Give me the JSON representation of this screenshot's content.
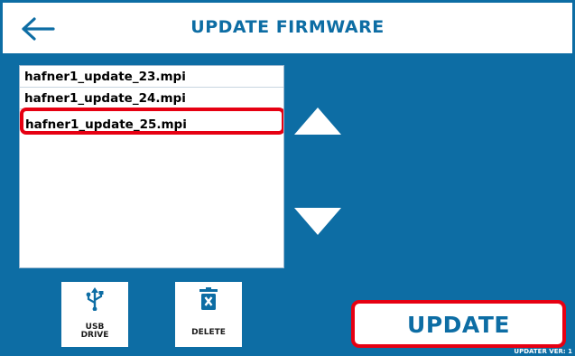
{
  "header": {
    "title": "UPDATE FIRMWARE",
    "back_icon": "left-arrow-icon"
  },
  "files": [
    {
      "name": "hafner1_update_23.mpi",
      "selected": false
    },
    {
      "name": "hafner1_update_24.mpi",
      "selected": false
    },
    {
      "name": "hafner1_update_25.mpi",
      "selected": true
    }
  ],
  "scroll": {
    "up_icon": "triangle-up-icon",
    "down_icon": "triangle-down-icon"
  },
  "tools": {
    "usb": {
      "label_line1": "USB",
      "label_line2": "DRIVE",
      "icon": "usb-icon"
    },
    "delete": {
      "label": "DELETE",
      "icon": "trash-icon"
    }
  },
  "update_button": {
    "label": "UPDATE"
  },
  "version_label": "UPDATER VER: 1",
  "colors": {
    "primary": "#0d6da4",
    "highlight": "#e60012",
    "surface": "#ffffff"
  }
}
